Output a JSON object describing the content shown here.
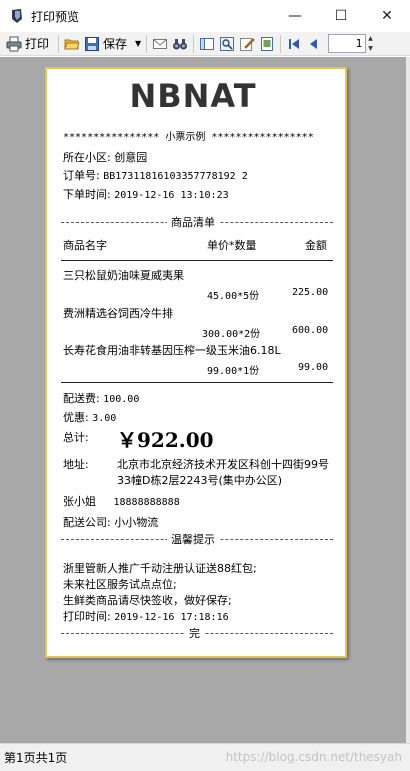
{
  "window": {
    "title": "打印预览",
    "minimize": "—",
    "maximize": "☐",
    "close": "✕"
  },
  "toolbar": {
    "print_label": "打印",
    "save_label": "保存",
    "page_value": "1"
  },
  "receipt": {
    "logo_text": "NBNAT",
    "header_line": "**************** 小票示例 *****************",
    "community_label": "所在小区:",
    "community_value": "创意园",
    "order_label": "订单号:",
    "order_value": "BB17311816103357778192 2",
    "order_time_label": "下单时间:",
    "order_time_value": "2019-12-16 13:10:23",
    "goods_title": "商品清单",
    "col_name": "商品名字",
    "col_price_qty": "单价*数量",
    "col_amount": "金额",
    "items": [
      {
        "name": "三只松鼠奶油味夏威夷果",
        "price_qty": "45.00*5份",
        "amount": "225.00"
      },
      {
        "name": "费洲精选谷饲西冷牛排",
        "price_qty": "300.00*2份",
        "amount": "600.00"
      },
      {
        "name": "长寿花食用油非转基因压榨一级玉米油6.18L",
        "price_qty": "99.00*1份",
        "amount": "99.00"
      }
    ],
    "delivery_fee_label": "配送费:",
    "delivery_fee_value": "100.00",
    "discount_label": "优惠:",
    "discount_value": "3.00",
    "total_label": "总计:",
    "total_value": "￥922.00",
    "address_label": "地址:",
    "address_line1": "北京市北京经济技术开发区科创十四街99号",
    "address_line2": "33幢D栋2层2243号(集中办公区)",
    "contact_name": "张小姐",
    "contact_phone": "18888888888",
    "delivery_company_label": "配送公司:",
    "delivery_company_value": "小小物流",
    "tips_title": "温馨提示",
    "tip1": "浙里管新人推广千动注册认证送88红包;",
    "tip2": "未来社区服务试点点位;",
    "tip3": "生鲜类商品请尽快签收，做好保存;",
    "print_time_label": "打印时间:",
    "print_time_value": "2019-12-16 17:18:16",
    "end_label": "完"
  },
  "status": {
    "page_text": "第1页共1页",
    "watermark": "https://blog.csdn.net/thesyah"
  }
}
